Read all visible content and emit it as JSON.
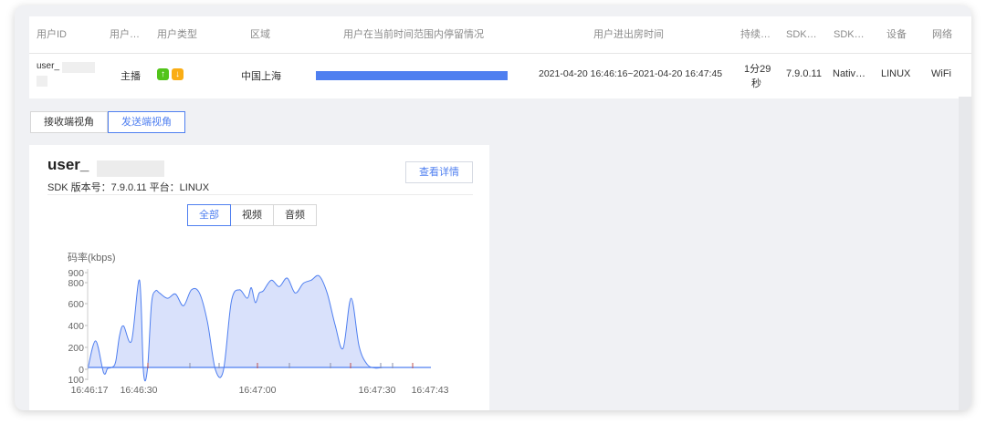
{
  "table": {
    "headers": [
      "用户ID",
      "用户…",
      "用户类型",
      "区域",
      "用户在当前时间范围内停留情况",
      "用户进出房时间",
      "持续…",
      "SDK…",
      "SDK…",
      "设备",
      "网络"
    ],
    "row": {
      "user_id": "user_",
      "role": "主播",
      "type_icons": [
        "arrow-up-icon",
        "arrow-down-icon"
      ],
      "region": "中国上海",
      "stay_fraction": 1.0,
      "time_range": "2021-04-20 16:46:16~2021-04-20 16:47:45",
      "duration_line1": "1分29",
      "duration_line2": "秒",
      "sdk_version": "7.9.0.11",
      "sdk_type": "Nativ…",
      "device": "LINUX",
      "network": "WiFi"
    }
  },
  "tabs": [
    "接收端视角",
    "发送端视角"
  ],
  "active_tab": 1,
  "card": {
    "user_name": "user_",
    "meta": "SDK 版本号：7.9.0.11   平台：LINUX",
    "detail_button": "查看详情",
    "filters": [
      "全部",
      "视频",
      "音频"
    ],
    "active_filter": 0
  },
  "colors": {
    "accent": "#4f7ff0",
    "area_fill": "#d9e1fb",
    "up_tag": "#52c41a",
    "down_tag": "#faad14"
  },
  "chart_data": {
    "type": "area",
    "ylabel": "码率(kbps)",
    "y_ticks": [
      100,
      0,
      200,
      400,
      600,
      800,
      900
    ],
    "x_ticks": [
      "16:46:17",
      "16:46:30",
      "16:47:00",
      "16:47:30",
      "16:47:43"
    ],
    "x_seconds": [
      0,
      2,
      4,
      5,
      6,
      7,
      8,
      9,
      11,
      13,
      14,
      15,
      16,
      17,
      18,
      20,
      22,
      24,
      26,
      28,
      30,
      32,
      34,
      36,
      38,
      40,
      41,
      42,
      43,
      44,
      46,
      48,
      50,
      52,
      54,
      56,
      58,
      60,
      62,
      64,
      66,
      68,
      70,
      72,
      74,
      76,
      78,
      80,
      81,
      82,
      83,
      84,
      85,
      86
    ],
    "series": [
      {
        "values": [
          -20,
          250,
          -50,
          -10,
          0,
          50,
          300,
          390,
          250,
          820,
          -50,
          -10,
          600,
          720,
          700,
          650,
          690,
          580,
          730,
          700,
          430,
          -20,
          -30,
          620,
          730,
          650,
          750,
          610,
          700,
          720,
          820,
          760,
          840,
          700,
          790,
          820,
          860,
          700,
          400,
          180,
          650,
          200,
          30,
          -5,
          0,
          0,
          0,
          0,
          0,
          0,
          0,
          0,
          0,
          0
        ]
      }
    ]
  }
}
